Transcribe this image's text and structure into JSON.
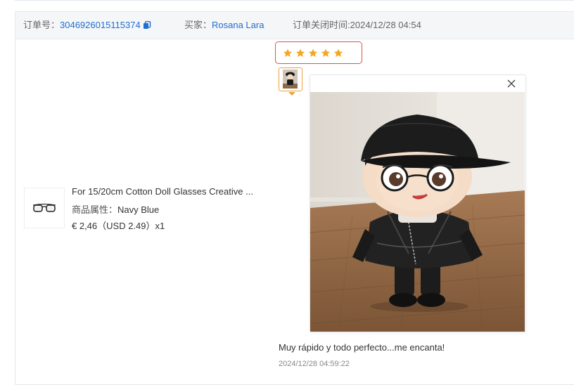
{
  "order_header": {
    "order_label": "订单号：",
    "order_number": "3046926015115374",
    "buyer_label": "买家：",
    "buyer_name": "Rosana Lara",
    "closed_label": "订单关闭时间:",
    "closed_time": "2024/12/28 04:54"
  },
  "product": {
    "title": "For 15/20cm Cotton Doll Glasses Creative ...",
    "attr_label": "商品属性：",
    "attr_value": "Navy Blue",
    "price": "€ 2,46（USD  2.49）x1"
  },
  "review": {
    "rating": 5,
    "rating_max": 5,
    "text": "Muy rápido y todo perfecto...me encanta!",
    "time": "2024/12/28 04:59:22"
  },
  "colors": {
    "star": "#f5a623",
    "link": "#1f6fd1",
    "highlight_border": "#d9534f",
    "thumb_border": "#f0a23a"
  },
  "icons": {
    "copy": "copy-icon",
    "close": "close-icon",
    "star": "star-icon"
  }
}
